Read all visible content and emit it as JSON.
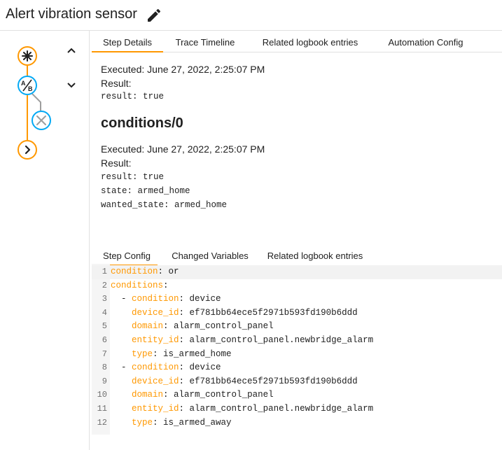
{
  "header": {
    "title": "Alert vibration sensor"
  },
  "top_tabs": [
    "Step Details",
    "Trace Timeline",
    "Related logbook entries",
    "Automation Config"
  ],
  "details": {
    "executed_1": "Executed: June 27, 2022, 2:25:07 PM",
    "result_label_1": "Result:",
    "result_value_1": "result: true",
    "section_title": "conditions/0",
    "executed_2": "Executed: June 27, 2022, 2:25:07 PM",
    "result_label_2": "Result:",
    "result_lines_2": [
      "result: true",
      "state: armed_home",
      "wanted_state: armed_home"
    ]
  },
  "bottom_tabs": [
    "Step Config",
    "Changed Variables",
    "Related logbook entries"
  ],
  "code": [
    {
      "n": "1",
      "indent": "",
      "key": "condition",
      "value": "or"
    },
    {
      "n": "2",
      "indent": "",
      "key": "conditions",
      "value": ""
    },
    {
      "n": "3",
      "indent": "  - ",
      "key": "condition",
      "value": "device"
    },
    {
      "n": "4",
      "indent": "    ",
      "key": "device_id",
      "value": "ef781bb64ece5f2971b593fd190b6ddd"
    },
    {
      "n": "5",
      "indent": "    ",
      "key": "domain",
      "value": "alarm_control_panel"
    },
    {
      "n": "6",
      "indent": "    ",
      "key": "entity_id",
      "value": "alarm_control_panel.newbridge_alarm"
    },
    {
      "n": "7",
      "indent": "    ",
      "key": "type",
      "value": "is_armed_home"
    },
    {
      "n": "8",
      "indent": "  - ",
      "key": "condition",
      "value": "device"
    },
    {
      "n": "9",
      "indent": "    ",
      "key": "device_id",
      "value": "ef781bb64ece5f2971b593fd190b6ddd"
    },
    {
      "n": "10",
      "indent": "    ",
      "key": "domain",
      "value": "alarm_control_panel"
    },
    {
      "n": "11",
      "indent": "    ",
      "key": "entity_id",
      "value": "alarm_control_panel.newbridge_alarm"
    },
    {
      "n": "12",
      "indent": "    ",
      "key": "type",
      "value": "is_armed_away"
    }
  ],
  "colors": {
    "accent": "#ff9800",
    "node_blue": "#03a9f4",
    "node_grey": "#9e9e9e"
  },
  "icons": [
    "pencil-icon",
    "trigger-asterisk-icon",
    "condition-ab-icon",
    "failed-x-icon",
    "action-chevron-icon",
    "chevron-up-icon",
    "chevron-down-icon"
  ]
}
